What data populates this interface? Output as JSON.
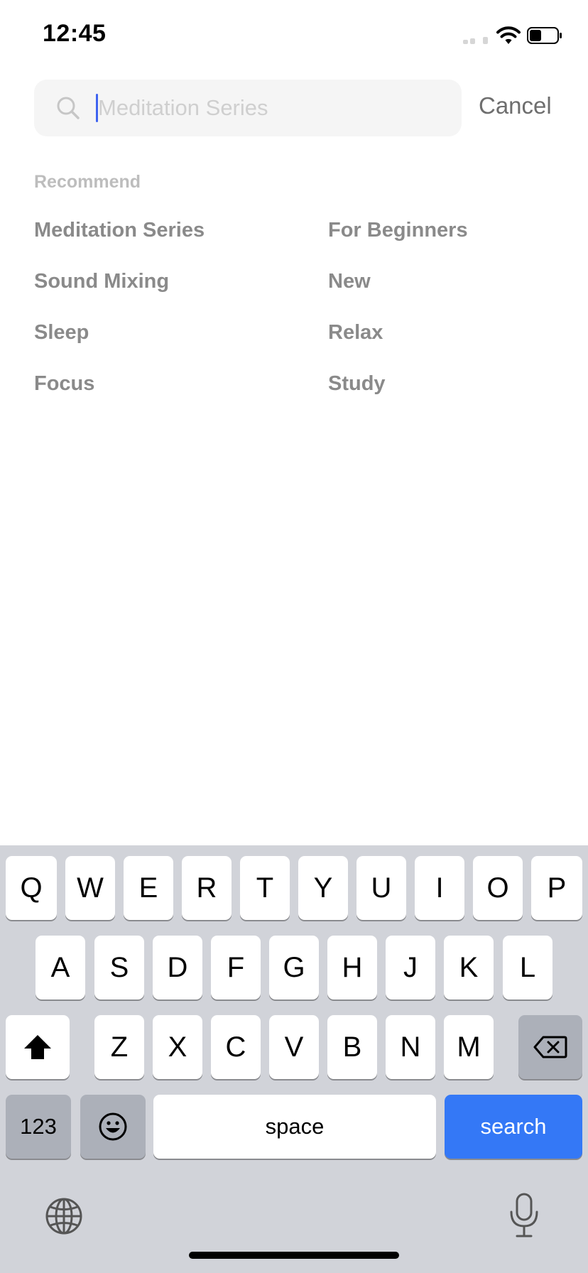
{
  "status_bar": {
    "time": "12:45"
  },
  "search": {
    "placeholder": "Meditation Series",
    "value": "",
    "cancel_label": "Cancel"
  },
  "recommend": {
    "title": "Recommend",
    "items": [
      "Meditation Series",
      "For Beginners",
      "Sound Mixing",
      "New",
      "Sleep",
      "Relax",
      "Focus",
      "Study"
    ]
  },
  "keyboard": {
    "row1": [
      "Q",
      "W",
      "E",
      "R",
      "T",
      "Y",
      "U",
      "I",
      "O",
      "P"
    ],
    "row2": [
      "A",
      "S",
      "D",
      "F",
      "G",
      "H",
      "J",
      "K",
      "L"
    ],
    "row3": [
      "Z",
      "X",
      "C",
      "V",
      "B",
      "N",
      "M"
    ],
    "numbers_label": "123",
    "space_label": "space",
    "search_label": "search",
    "icons": {
      "shift": "shift-icon",
      "delete": "delete-icon",
      "emoji": "emoji-icon",
      "globe": "globe-icon",
      "mic": "microphone-icon"
    }
  },
  "colors": {
    "accent": "#3478f6",
    "caret": "#3f63f0",
    "keyboard_bg": "#d1d3d9"
  }
}
